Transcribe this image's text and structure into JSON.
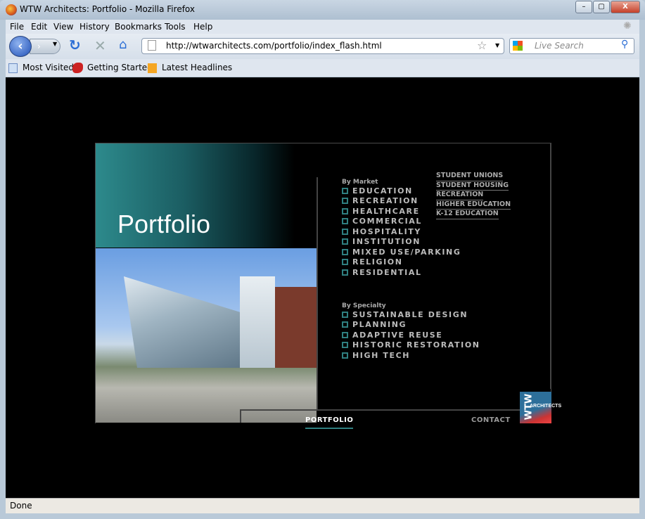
{
  "window": {
    "title": "WTW Architects: Portfolio - Mozilla Firefox",
    "min": "–",
    "max": "▢",
    "close": "X"
  },
  "menu": [
    "File",
    "Edit",
    "View",
    "History",
    "Bookmarks",
    "Tools",
    "Help"
  ],
  "nav": {
    "url": "http://wtwarchitects.com/portfolio/index_flash.html",
    "search_placeholder": "Live Search"
  },
  "bookmarks": [
    "Most Visited",
    "Getting Started",
    "Latest Headlines"
  ],
  "status": "Done",
  "page": {
    "title": "Portfolio",
    "by_market_label": "By Market",
    "market": [
      "EDUCATION",
      "RECREATION",
      "HEALTHCARE",
      "COMMERCIAL",
      "HOSPITALITY",
      "INSTITUTION",
      "MIXED USE/PARKING",
      "RELIGION",
      "RESIDENTIAL"
    ],
    "education_sub": [
      "STUDENT UNIONS",
      "STUDENT HOUSING",
      "RECREATION",
      "HIGHER EDUCATION",
      "K-12 EDUCATION"
    ],
    "by_specialty_label": "By Specialty",
    "specialty": [
      "SUSTAINABLE DESIGN",
      "PLANNING",
      "ADAPTIVE REUSE",
      "HISTORIC RESTORATION",
      "HIGH TECH"
    ],
    "nav_portfolio": "PORTFOLIO",
    "nav_contact": "CONTACT",
    "logo_text": "WTW",
    "logo_sub": "ARCHITECTS",
    "colors": {
      "accent": "#2f7f80"
    }
  }
}
